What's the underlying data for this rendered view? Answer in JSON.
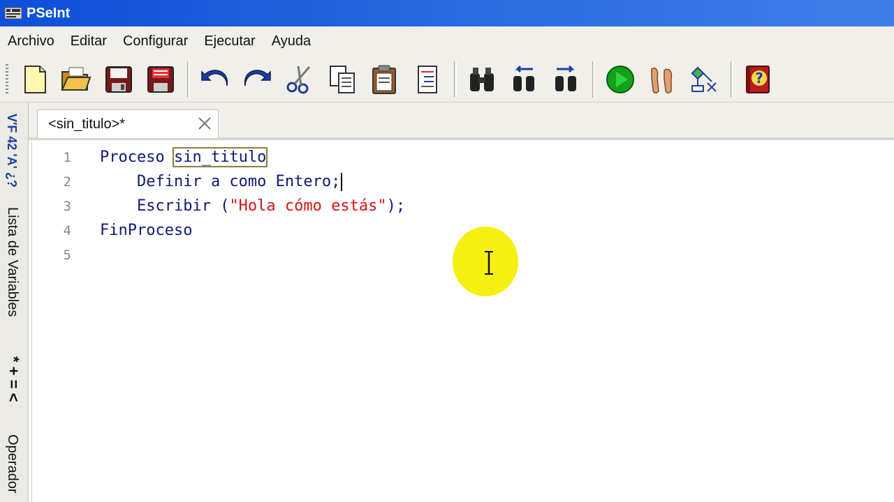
{
  "window": {
    "title": "PSeInt"
  },
  "menu": [
    "Archivo",
    "Editar",
    "Configurar",
    "Ejecutar",
    "Ayuda"
  ],
  "toolbar": {
    "buttons": [
      {
        "name": "new-file",
        "icon": "new-file-icon"
      },
      {
        "name": "open",
        "icon": "open-folder-icon"
      },
      {
        "name": "save",
        "icon": "save-icon"
      },
      {
        "name": "save-as",
        "icon": "save-as-icon"
      },
      {
        "name": "undo",
        "icon": "undo-icon"
      },
      {
        "name": "redo",
        "icon": "redo-icon"
      },
      {
        "name": "cut",
        "icon": "scissors-icon"
      },
      {
        "name": "copy",
        "icon": "copy-icon"
      },
      {
        "name": "paste",
        "icon": "paste-icon"
      },
      {
        "name": "indent",
        "icon": "indent-icon"
      },
      {
        "name": "find",
        "icon": "binoculars-icon"
      },
      {
        "name": "find-previous",
        "icon": "find-prev-icon"
      },
      {
        "name": "find-next",
        "icon": "find-next-icon"
      },
      {
        "name": "run",
        "icon": "play-icon"
      },
      {
        "name": "step-by-step",
        "icon": "footprints-icon"
      },
      {
        "name": "flowchart",
        "icon": "flowchart-icon"
      },
      {
        "name": "help",
        "icon": "help-book-icon"
      }
    ]
  },
  "sidebar": {
    "variables_glyphs": "V′F 42 'A' ¿?",
    "variables_label": "Lista de Variables",
    "operators_glyphs": "* + = <",
    "operators_label": "Operador"
  },
  "tab": {
    "label": "<sin_titulo>*"
  },
  "editor": {
    "lines": [
      {
        "num": "1",
        "kw": "Proceso ",
        "id": "sin_titulo"
      },
      {
        "num": "2",
        "indent": "    ",
        "text": "Definir a como Entero;"
      },
      {
        "num": "3",
        "indent": "    ",
        "kw": "Escribir (",
        "str": "\"Hola cómo estás\"",
        "tail": ");"
      },
      {
        "num": "4",
        "kw": "FinProceso"
      },
      {
        "num": "5"
      }
    ]
  }
}
